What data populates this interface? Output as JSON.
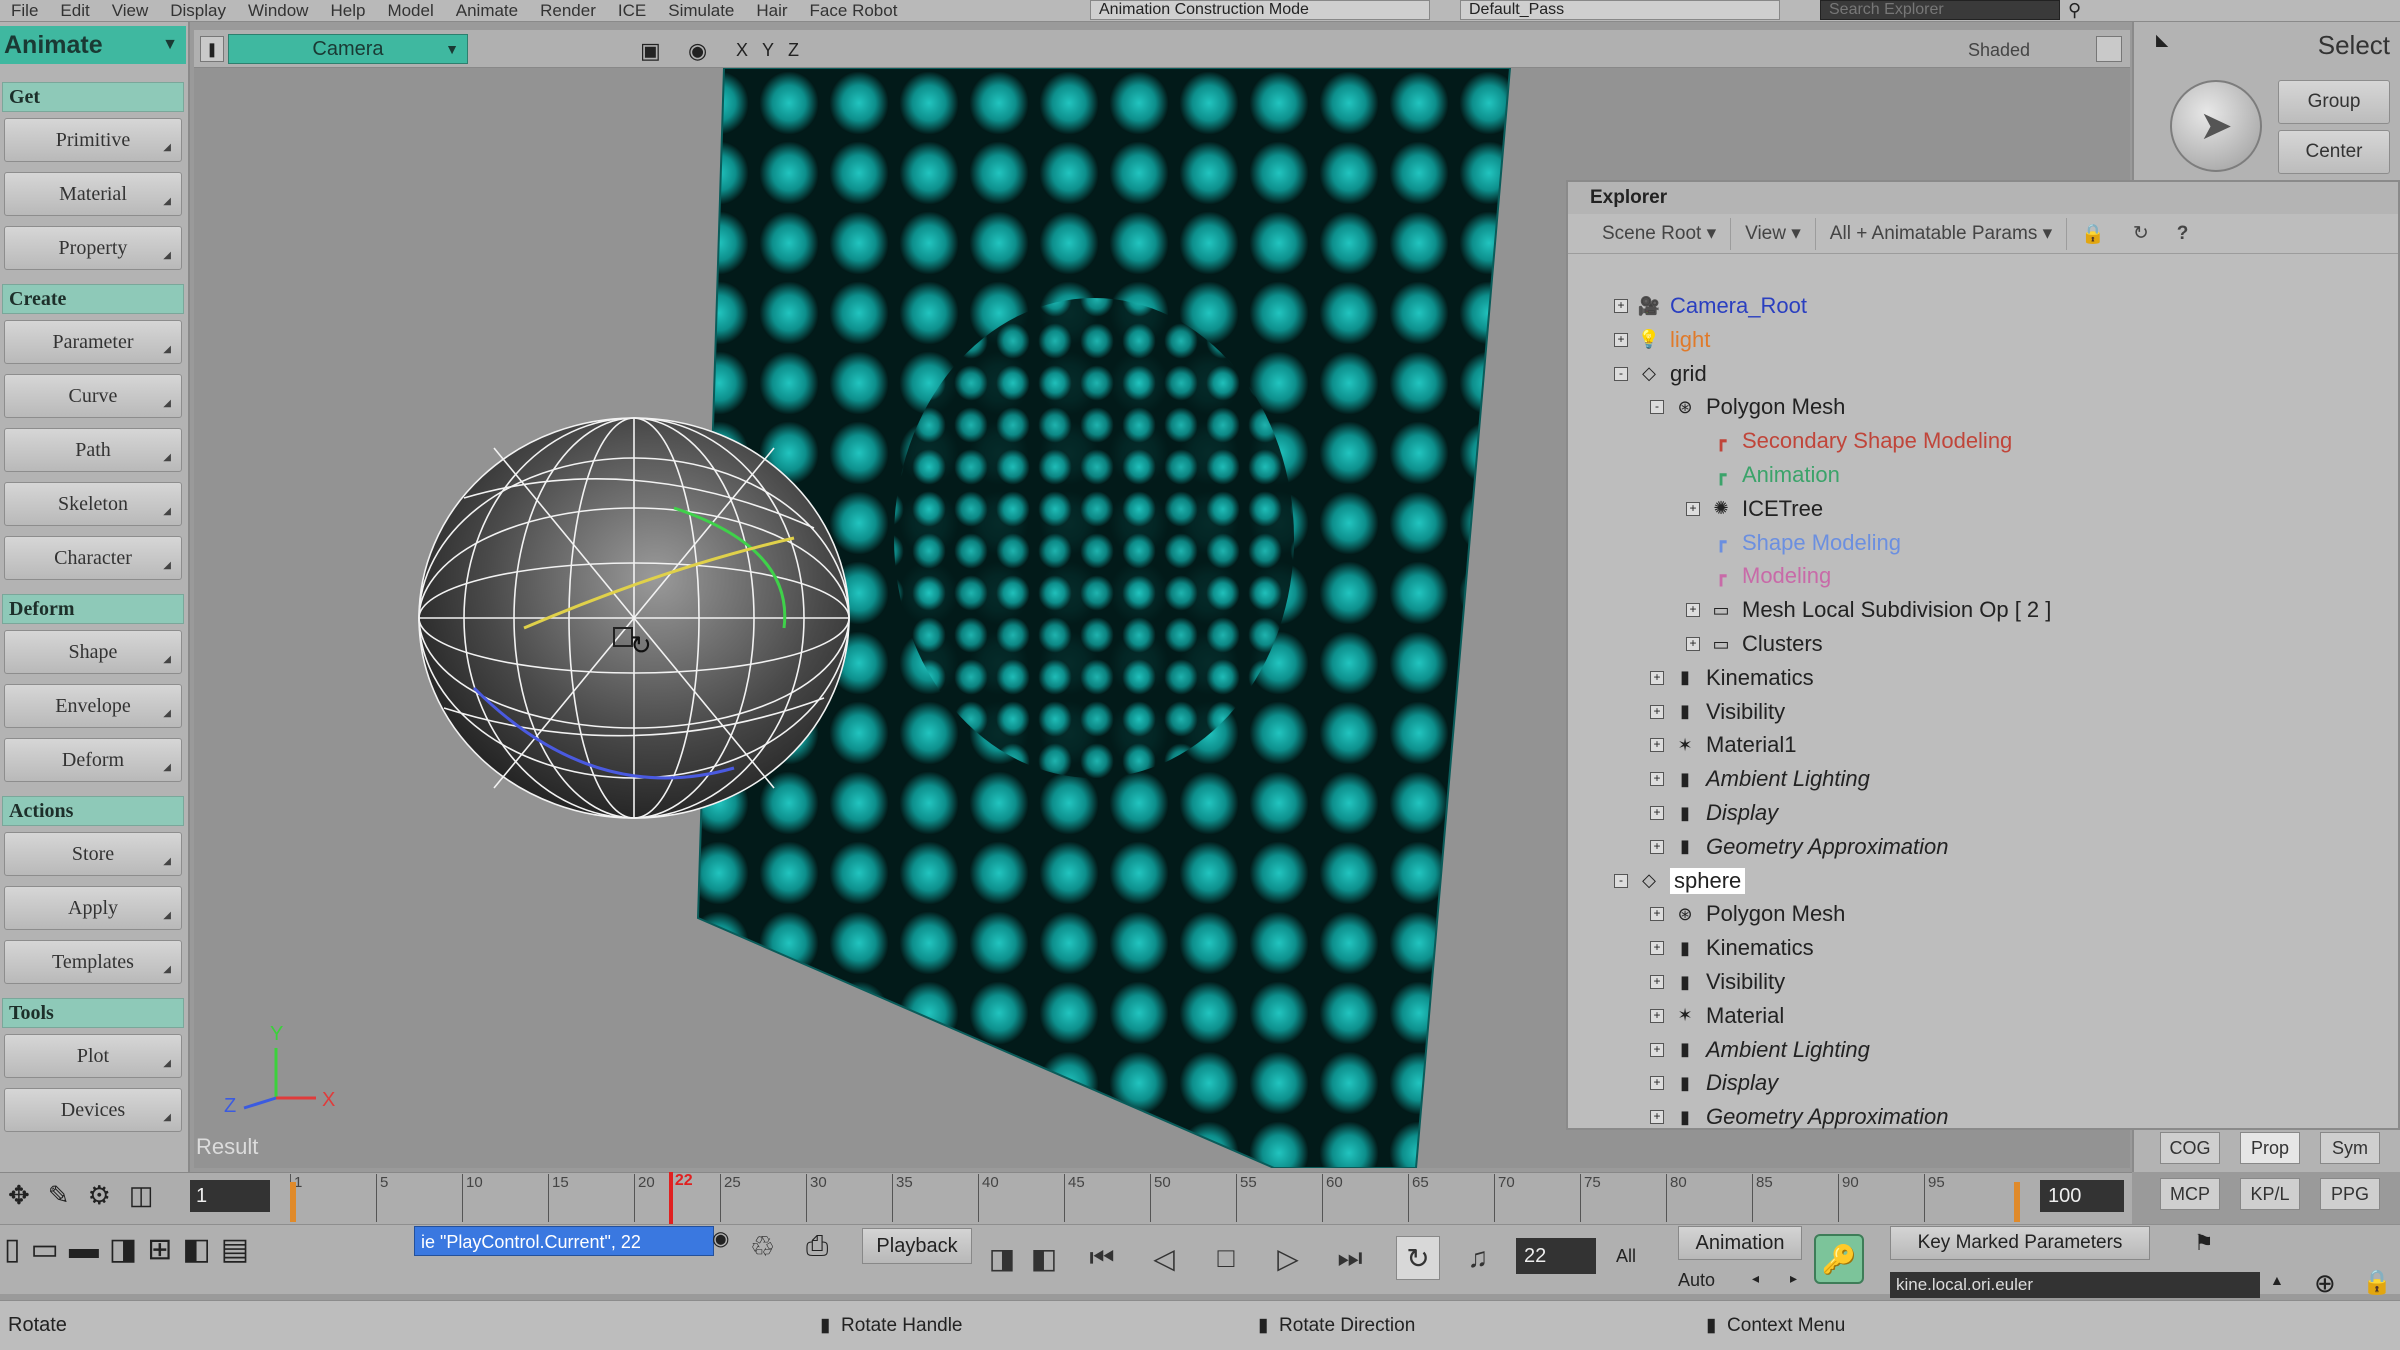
{
  "menu": [
    "File",
    "Edit",
    "View",
    "Display",
    "Window",
    "Help",
    "Model",
    "Animate",
    "Render",
    "ICE",
    "Simulate",
    "Hair",
    "Face Robot"
  ],
  "toolbar": {
    "mode_combo": "Animation Construction Mode",
    "pass_combo": "Default_Pass",
    "search_placeholder": "Search Explorer"
  },
  "left_panel": {
    "mode": "Animate",
    "sections": [
      {
        "title": "Get",
        "buttons": [
          "Primitive",
          "Material",
          "Property"
        ]
      },
      {
        "title": "Create",
        "buttons": [
          "Parameter",
          "Curve",
          "Path",
          "Skeleton",
          "Character"
        ]
      },
      {
        "title": "Deform",
        "buttons": [
          "Shape",
          "Envelope",
          "Deform"
        ]
      },
      {
        "title": "Actions",
        "buttons": [
          "Store",
          "Apply",
          "Templates"
        ]
      },
      {
        "title": "Tools",
        "buttons": [
          "Plot",
          "Devices"
        ]
      }
    ]
  },
  "viewport": {
    "camera": "Camera",
    "axis_labels": [
      "X",
      "Y",
      "Z"
    ],
    "shading_mode": "Shaded",
    "result_label": "Result",
    "gizmo": {
      "x": "X",
      "y": "Y",
      "z": "Z"
    }
  },
  "right_panel": {
    "title": "Select",
    "buttons": [
      "Group",
      "Center"
    ],
    "bottom_tabs": [
      [
        "COG",
        "Prop",
        "Sym"
      ],
      [
        "MCP",
        "KP/L",
        "PPG"
      ]
    ]
  },
  "explorer": {
    "title": "Explorer",
    "toolbar": [
      "Scene Root",
      "View",
      "All + Animatable Params"
    ],
    "rows": [
      {
        "indent": 0,
        "label": "Camera_Root",
        "color": "#2a3fc0",
        "icon": "camera-icon",
        "exp": "+",
        "italic": false
      },
      {
        "indent": 0,
        "label": "light",
        "color": "#e07a2a",
        "icon": "light-icon",
        "exp": "+",
        "italic": false
      },
      {
        "indent": 0,
        "label": "grid",
        "color": "#222",
        "icon": "null-icon",
        "exp": "-",
        "italic": false
      },
      {
        "indent": 1,
        "label": "Polygon Mesh",
        "color": "#222",
        "icon": "mesh-icon",
        "exp": "-",
        "italic": false
      },
      {
        "indent": 2,
        "label": "Secondary Shape Modeling",
        "color": "#c0453a",
        "icon": "operator-icon",
        "exp": "",
        "italic": false
      },
      {
        "indent": 2,
        "label": "Animation",
        "color": "#3ba36a",
        "icon": "operator-icon",
        "exp": "",
        "italic": false
      },
      {
        "indent": 2,
        "label": "ICETree",
        "color": "#222",
        "icon": "ice-icon",
        "exp": "+",
        "italic": false
      },
      {
        "indent": 2,
        "label": "Shape Modeling",
        "color": "#6b8fe0",
        "icon": "operator-icon",
        "exp": "",
        "italic": false
      },
      {
        "indent": 2,
        "label": "Modeling",
        "color": "#c86aa8",
        "icon": "operator-icon",
        "exp": "",
        "italic": false
      },
      {
        "indent": 2,
        "label": "Mesh Local Subdivision Op [ 2 ]",
        "color": "#222",
        "icon": "folder-icon",
        "exp": "+",
        "italic": false
      },
      {
        "indent": 2,
        "label": "Clusters",
        "color": "#222",
        "icon": "folder-icon",
        "exp": "+",
        "italic": false
      },
      {
        "indent": 1,
        "label": "Kinematics",
        "color": "#222",
        "icon": "property-icon",
        "exp": "+",
        "italic": false
      },
      {
        "indent": 1,
        "label": "Visibility",
        "color": "#222",
        "icon": "property-icon",
        "exp": "+",
        "italic": false
      },
      {
        "indent": 1,
        "label": "Material1",
        "color": "#222",
        "icon": "material-icon",
        "exp": "+",
        "italic": false
      },
      {
        "indent": 1,
        "label": "Ambient Lighting",
        "color": "#222",
        "icon": "property-icon",
        "exp": "+",
        "italic": true
      },
      {
        "indent": 1,
        "label": "Display",
        "color": "#222",
        "icon": "property-icon",
        "exp": "+",
        "italic": true
      },
      {
        "indent": 1,
        "label": "Geometry Approximation",
        "color": "#222",
        "icon": "property-icon",
        "exp": "+",
        "italic": true
      },
      {
        "indent": 0,
        "label": "sphere",
        "color": "#222",
        "icon": "null-icon",
        "exp": "-",
        "italic": false,
        "selected": true
      },
      {
        "indent": 1,
        "label": "Polygon Mesh",
        "color": "#222",
        "icon": "mesh-icon",
        "exp": "+",
        "italic": false
      },
      {
        "indent": 1,
        "label": "Kinematics",
        "color": "#222",
        "icon": "property-icon",
        "exp": "+",
        "italic": false
      },
      {
        "indent": 1,
        "label": "Visibility",
        "color": "#222",
        "icon": "property-icon",
        "exp": "+",
        "italic": false
      },
      {
        "indent": 1,
        "label": "Material",
        "color": "#222",
        "icon": "material-icon",
        "exp": "+",
        "italic": false
      },
      {
        "indent": 1,
        "label": "Ambient Lighting",
        "color": "#222",
        "icon": "property-icon",
        "exp": "+",
        "italic": true
      },
      {
        "indent": 1,
        "label": "Display",
        "color": "#222",
        "icon": "property-icon",
        "exp": "+",
        "italic": true
      },
      {
        "indent": 1,
        "label": "Geometry Approximation",
        "color": "#222",
        "icon": "property-icon",
        "exp": "+",
        "italic": true
      }
    ]
  },
  "timeline": {
    "start": "1",
    "end": "100",
    "current": "22",
    "ticks": [
      "1",
      "5",
      "10",
      "15",
      "20",
      "25",
      "30",
      "35",
      "40",
      "45",
      "50",
      "55",
      "60",
      "65",
      "70",
      "75",
      "80",
      "85",
      "90",
      "95"
    ]
  },
  "playback": {
    "command_field": "ie \"PlayControl.Current\", 22",
    "playback_label": "Playback",
    "frame": "22",
    "all_label": "All",
    "animation_label": "Animation",
    "auto_label": "Auto",
    "key_marked": "Key Marked Parameters",
    "kine_field": "kine.local.ori.euler"
  },
  "status": {
    "left": "Rotate",
    "hint1": "Rotate Handle",
    "hint2": "Rotate Direction",
    "hint3": "Context Menu"
  },
  "colors": {
    "accent_teal": "#3fb8a0",
    "panel_gray": "#b3b3b3",
    "viewport_gray": "#939393",
    "texture_teal": "#0c9a96",
    "selection_blue": "#3a78e0"
  }
}
